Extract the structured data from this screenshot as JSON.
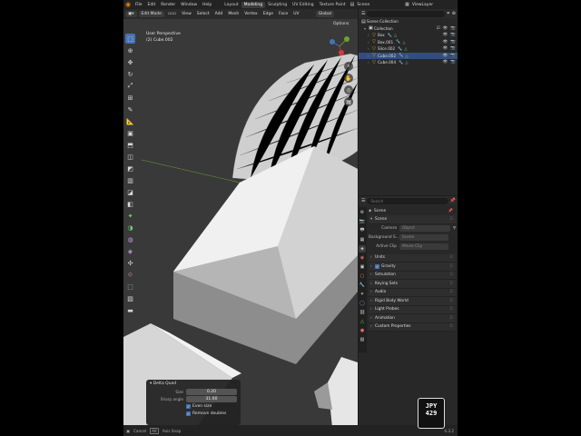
{
  "topbar": {
    "menus": [
      "File",
      "Edit",
      "Render",
      "Window",
      "Help"
    ],
    "workspaces": [
      "Layout",
      "Modeling",
      "Sculpting",
      "UV Editing",
      "Texture Paint"
    ],
    "active_workspace": "Modeling",
    "scene": "Scene",
    "view_layer": "ViewLayer"
  },
  "viewport_header": {
    "mode": "Edit Mode",
    "menus": [
      "View",
      "Select",
      "Add",
      "Mesh",
      "Vertex",
      "Edge",
      "Face",
      "UV"
    ],
    "transform": "Global",
    "options": "Options"
  },
  "viewport": {
    "perspective": "User Perspective",
    "object": "(2) Cube.002"
  },
  "operator_panel": {
    "title": "Delta Quad",
    "size_label": "Size",
    "size_value": "0.20",
    "sharp_label": "Sharp angle",
    "sharp_value": "31.60",
    "even_size": "Even size",
    "remove_doubles": "Remove doubles"
  },
  "statusbar": {
    "items": [
      "Cancel",
      "Alt",
      "Axis Snap"
    ],
    "version": "4.3.2"
  },
  "outliner": {
    "search_placeholder": "",
    "scene_collection": "Scene Collection",
    "collection": "Collection",
    "items": [
      {
        "name": "Box",
        "selected": false
      },
      {
        "name": "Box.001",
        "selected": false
      },
      {
        "name": "Slice.002",
        "selected": false
      },
      {
        "name": "Cube.002",
        "selected": true
      },
      {
        "name": "Cube.004",
        "selected": false
      }
    ]
  },
  "properties": {
    "search_placeholder": "Search",
    "scene_name": "Scene",
    "scene_section": "Scene",
    "camera_label": "Camera",
    "camera_value": "Object",
    "background_label": "Background S...",
    "background_value": "Scene",
    "active_clip_label": "Active Clip",
    "active_clip_value": "Movie Clip",
    "sections": [
      "Units",
      "Gravity",
      "Simulation",
      "Keying Sets",
      "Audio",
      "Rigid Body World",
      "Light Probes",
      "Animation",
      "Custom Properties"
    ]
  },
  "badge": {
    "line1": "JPY",
    "line2": "429"
  },
  "colors": {
    "accent": "#4772b3",
    "selection": "#334d80",
    "viewport_bg": "#393939",
    "mesh_light": "#c8c8c8"
  }
}
